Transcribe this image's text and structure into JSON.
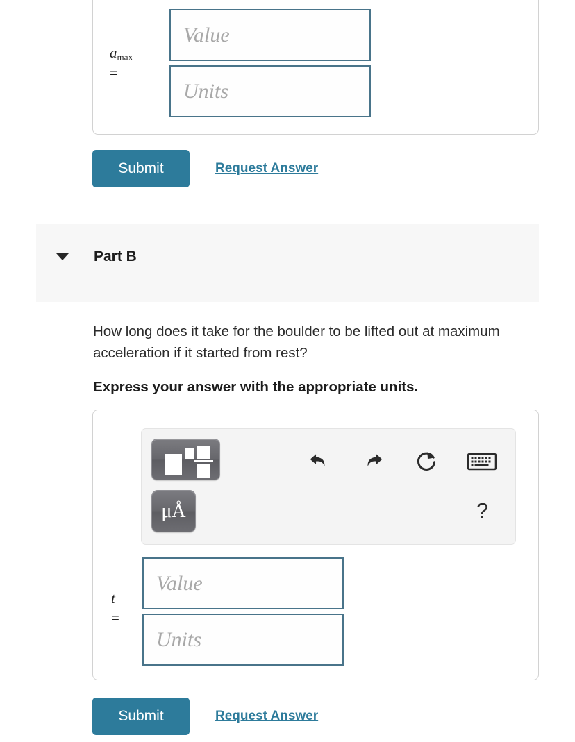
{
  "page": {
    "background": "#ffffff",
    "accent_color": "#2d7b9b",
    "field_border_color": "#49748a",
    "band_color": "#f7f7f7"
  },
  "part_a": {
    "answer_box": {
      "variable_label": "a",
      "variable_subscript": "max",
      "equals": "=",
      "value_placeholder": "Value",
      "units_placeholder": "Units"
    },
    "submit_label": "Submit",
    "request_answer_label": "Request Answer"
  },
  "part_b": {
    "caret_icon": "caret-down-icon",
    "title": "Part B",
    "question": "How long does it take for the boulder to be lifted out at maximum acceleration if it started from rest?",
    "instruction": "Express your answer with the appropriate units.",
    "toolbar": {
      "template_button": {
        "icon": "math-template-icon",
        "label": ""
      },
      "units_button": {
        "icon": "units-icon",
        "label": "μÅ"
      },
      "undo_icon": "undo-icon",
      "redo_icon": "redo-icon",
      "reset_icon": "reset-icon",
      "keyboard_icon": "keyboard-icon",
      "help_label": "?"
    },
    "answer_box": {
      "variable_label": "t",
      "equals": "=",
      "value_placeholder": "Value",
      "units_placeholder": "Units"
    },
    "submit_label": "Submit",
    "request_answer_label": "Request Answer"
  }
}
